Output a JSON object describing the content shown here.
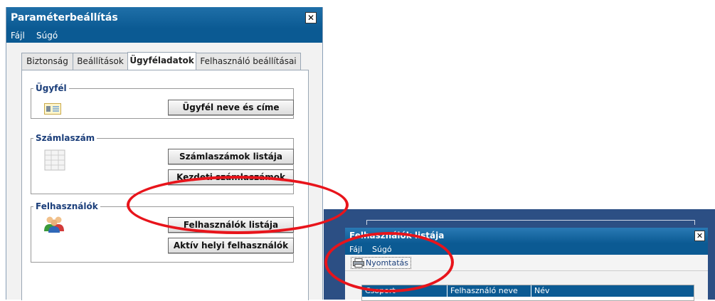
{
  "window1": {
    "title": "Paraméterbeállítás",
    "close": "✕",
    "menu": [
      "Fájl",
      "Súgó"
    ],
    "tabs": [
      {
        "label": "Biztonság"
      },
      {
        "label": "Beállítások"
      },
      {
        "label": "Ügyféladatok",
        "active": true
      },
      {
        "label": "Felhasználó beállításai"
      }
    ],
    "groups": {
      "ugyfel": {
        "legend": "Ügyfél",
        "buttons": [
          "Ügyfél neve és címe"
        ],
        "icon": "id-card-icon"
      },
      "szamla": {
        "legend": "Számlaszám",
        "buttons": [
          "Számlaszámok listája",
          "Kezdeti számlaszámok"
        ],
        "icon": "document-list-icon"
      },
      "felh": {
        "legend": "Felhasználók",
        "buttons": [
          "Felhasználók listája",
          "Aktív helyi felhasználók"
        ],
        "icon": "users-icon"
      }
    }
  },
  "window2": {
    "title": "Felhasználók listája",
    "close": "✕",
    "menu": [
      "Fájl",
      "Súgó"
    ],
    "print_label": "Nyomtatás",
    "columns": [
      "Csoport",
      "Felhasználó neve",
      "Név"
    ]
  },
  "colors": {
    "highlight": "#e8141b",
    "titlebar": "#0b5a93"
  }
}
